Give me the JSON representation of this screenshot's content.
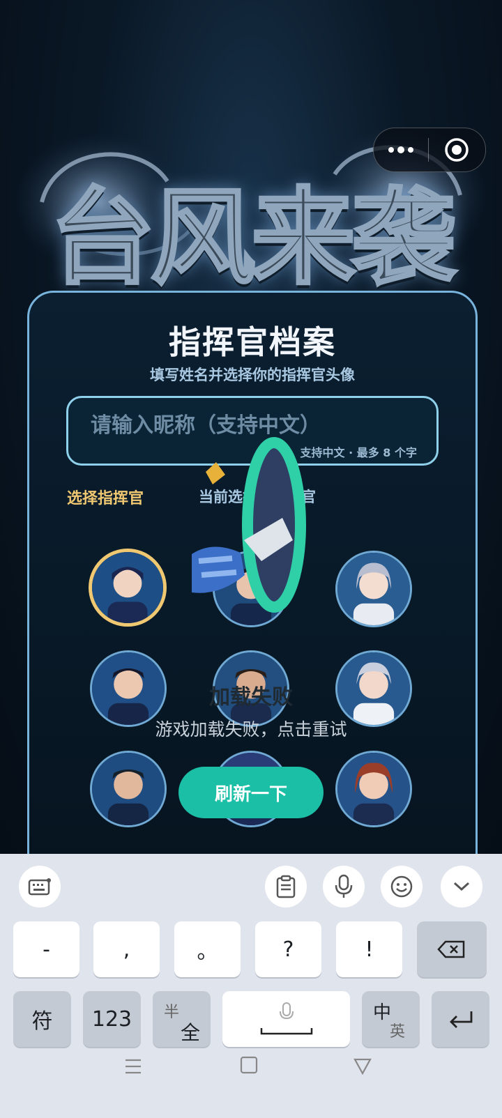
{
  "hero": {
    "title": "台风来袭"
  },
  "capsule": {
    "more_icon": "more-dots-icon",
    "close_icon": "target-circle-icon"
  },
  "card": {
    "title": "指挥官档案",
    "subtitle": "填写姓名并选择你的指挥官头像",
    "nickname": {
      "placeholder": "请输入昵称（支持中文）",
      "value": "",
      "hint": "支持中文 · 最多 8 个字"
    },
    "select_label": "选择指挥官",
    "current_label": "当前选择：研判官"
  },
  "error": {
    "title": "加载失败",
    "description": "游戏加载失败，点击重试",
    "refresh_label": "刷新一下"
  },
  "keyboard": {
    "toolbar": [
      "keyboard-icon",
      "clipboard-icon",
      "microphone-icon",
      "emoji-icon",
      "collapse-chevron-icon"
    ],
    "row1": [
      "-",
      ",",
      "。",
      "?",
      "!"
    ],
    "row2": {
      "symbols": "符",
      "numbers": "123",
      "half_full_top": "半",
      "half_full_bottom": "全",
      "lang_top": "中",
      "lang_bottom": "英"
    }
  },
  "colors": {
    "accent_gold": "#f0c872",
    "accent_teal": "#1bbfa6",
    "card_border": "#78b3dc"
  }
}
